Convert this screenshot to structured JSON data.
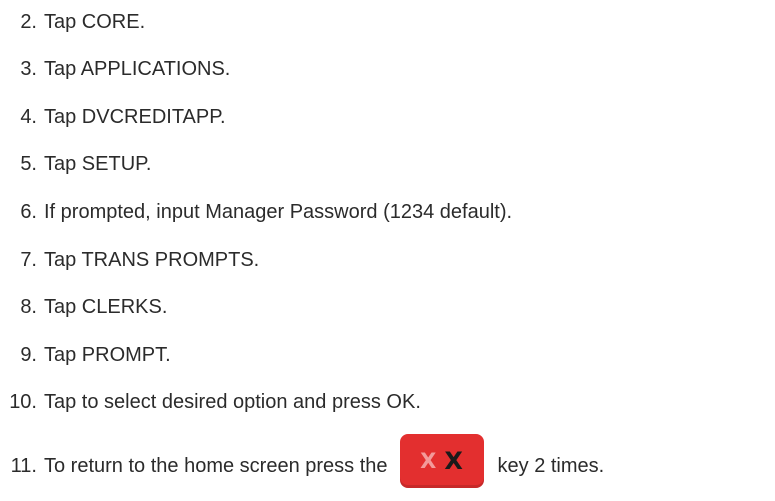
{
  "steps": [
    {
      "number": "2.",
      "text": "Tap CORE."
    },
    {
      "number": "3.",
      "text": "Tap APPLICATIONS."
    },
    {
      "number": "4.",
      "text": "Tap DVCREDITAPP."
    },
    {
      "number": "5.",
      "text": "Tap SETUP."
    },
    {
      "number": "6.",
      "text": "If prompted, input Manager Password (1234 default)."
    },
    {
      "number": "7.",
      "text": "Tap TRANS PROMPTS."
    },
    {
      "number": "8.",
      "text": "Tap CLERKS."
    },
    {
      "number": "9.",
      "text": "Tap PROMPT."
    },
    {
      "number": "10.",
      "text": "Tap to select desired option and press OK."
    },
    {
      "number": "11.",
      "text": "To return to the home screen press the",
      "text_after": "key 2 times."
    }
  ],
  "key_icon": {
    "label_left": "X",
    "label_right": "X",
    "background": "#e32f2f",
    "icon_name": "cancel-key-icon"
  }
}
